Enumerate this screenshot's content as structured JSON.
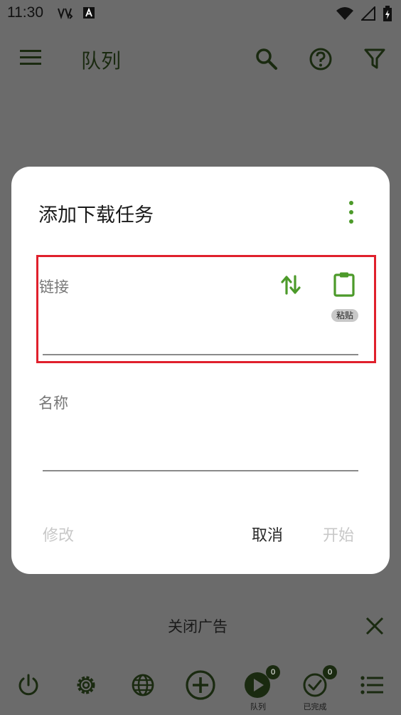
{
  "status_bar": {
    "time": "11:30"
  },
  "app_bar": {
    "title": "队列",
    "icons": [
      "menu-icon",
      "search-icon",
      "help-icon",
      "filter-icon"
    ]
  },
  "dialog": {
    "title": "添加下载任务",
    "link_field": {
      "label": "链接",
      "paste_tooltip": "粘贴"
    },
    "name_field": {
      "label": "名称"
    },
    "buttons": {
      "modify": "修改",
      "cancel": "取消",
      "start": "开始"
    }
  },
  "ad_bar": {
    "text": "关闭广告"
  },
  "bottom_nav": {
    "items": [
      {
        "icon": "power-icon",
        "label": ""
      },
      {
        "icon": "gear-icon",
        "label": ""
      },
      {
        "icon": "globe-icon",
        "label": ""
      },
      {
        "icon": "add-circle-icon",
        "label": ""
      },
      {
        "icon": "play-icon",
        "label": "队列",
        "badge": "0"
      },
      {
        "icon": "check-circle-icon",
        "label": "已完成",
        "badge": "0"
      },
      {
        "icon": "list-icon",
        "label": ""
      }
    ]
  },
  "colors": {
    "accent": "#4c9a2a",
    "icon_dark": "#1a2a10",
    "highlight_border": "#e0202c",
    "scrim": "#6b6b6b"
  }
}
